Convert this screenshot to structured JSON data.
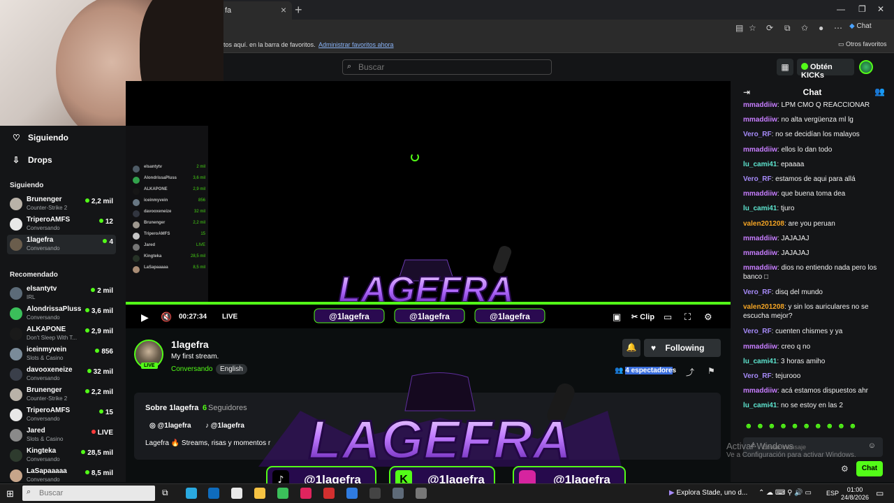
{
  "browser": {
    "tab_title": "fa",
    "favbar_text": "tos aquí. en la barra de favoritos.",
    "favbar_link": "Administrar favoritos ahora",
    "other_favs": "Otros favoritos",
    "copilot_label": "Chat"
  },
  "header": {
    "search_placeholder": "Buscar",
    "kicks_label": "Obtén KICKs"
  },
  "sidebar": {
    "nav": [
      {
        "label": "Siguiendo",
        "icon": "heart-icon"
      },
      {
        "label": "Drops",
        "icon": "drops-icon"
      }
    ],
    "following_title": "Siguiendo",
    "following": [
      {
        "name": "Brunenger",
        "category": "Counter-Strike 2",
        "viewers": "2,2 mil",
        "color": "#b9b2a8"
      },
      {
        "name": "TriperoAMFS",
        "category": "Conversando",
        "viewers": "12",
        "color": "#e8e8e8"
      },
      {
        "name": "1lagefra",
        "category": "Conversando",
        "viewers": "4",
        "color": "#6a5d4c"
      }
    ],
    "recommended_title": "Recomendado",
    "recommended": [
      {
        "name": "elsantytv",
        "category": "IRL",
        "viewers": "2 mil",
        "color": "#5c6b78"
      },
      {
        "name": "AlondrissaPluss",
        "category": "Conversando",
        "viewers": "3,6 mil",
        "color": "#3bbf5a"
      },
      {
        "name": "ALKAPONE",
        "category": "Don't Sleep With T...",
        "viewers": "2,9 mil",
        "color": "#1a1a1a"
      },
      {
        "name": "iceinmyvein",
        "category": "Slots & Casino",
        "viewers": "856",
        "color": "#7a8b99"
      },
      {
        "name": "davooxeneize",
        "category": "Conversando",
        "viewers": "32 mil",
        "color": "#3a3f4a"
      },
      {
        "name": "Brunenger",
        "category": "Counter-Strike 2",
        "viewers": "2,2 mil",
        "color": "#b9b2a8"
      },
      {
        "name": "TriperoAMFS",
        "category": "Conversando",
        "viewers": "15",
        "color": "#e8e8e8"
      },
      {
        "name": "Jared",
        "category": "Slots & Casino",
        "viewers": "LIVE",
        "color": "#8a8a8a"
      },
      {
        "name": "Kingteka",
        "category": "Conversando",
        "viewers": "28,5 mil",
        "color": "#2e3b2e"
      },
      {
        "name": "LaSapaaaaa",
        "category": "Conversando",
        "viewers": "8,5 mil",
        "color": "#c7a58a"
      }
    ]
  },
  "player": {
    "time": "00:27:34",
    "live": "LIVE",
    "clip": "Clip",
    "banner_text": "LAGEFRA",
    "banner_handle": "@1lagefra"
  },
  "channel": {
    "name": "1lagefra",
    "live_badge": "LIVE",
    "title": "My first stream.",
    "category": "Conversando",
    "language": "English",
    "follow_label": "Following",
    "viewers_highlight": "4 espectadore",
    "viewers_tail": "s"
  },
  "about": {
    "title": "Sobre 1lagefra",
    "followers_count": "6",
    "followers_label": "Seguidores",
    "instagram": "@1lagefra",
    "tiktok": "@1lagefra",
    "description": "Lagefra 🔥 Streams, risas y momentos r"
  },
  "chat": {
    "title": "Chat",
    "messages": [
      {
        "user": "mmaddiiw",
        "text": "LPM CMO Q REACCIONAR",
        "color": "#c77dff"
      },
      {
        "user": "mmaddiiw",
        "text": "no alta vergüenza ml lg",
        "color": "#c77dff"
      },
      {
        "user": "Vero_RF",
        "text": "no se decidían los malayos",
        "color": "#a78bfa"
      },
      {
        "user": "mmaddiiw",
        "text": "ellos lo dan todo",
        "color": "#c77dff"
      },
      {
        "user": "lu_cami41",
        "text": "epaaaa",
        "color": "#5ee6d0"
      },
      {
        "user": "Vero_RF",
        "text": "estamos de aqui para allá",
        "color": "#a78bfa"
      },
      {
        "user": "mmaddiiw",
        "text": "que buena toma dea",
        "color": "#c77dff"
      },
      {
        "user": "lu_cami41",
        "text": "tjuro",
        "color": "#5ee6d0"
      },
      {
        "user": "valen201208",
        "text": "are you peruan",
        "color": "#f5a524"
      },
      {
        "user": "mmaddiiw",
        "text": "JAJAJAJ",
        "color": "#c77dff"
      },
      {
        "user": "mmaddiiw",
        "text": "JAJAJAJ",
        "color": "#c77dff"
      },
      {
        "user": "mmaddiiw",
        "text": "dios no entiendo nada pero los banco □",
        "color": "#c77dff"
      },
      {
        "user": "Vero_RF",
        "text": "disq del mundo",
        "color": "#a78bfa"
      },
      {
        "user": "valen201208",
        "text": "y sin los auriculares no se escucha mejor?",
        "color": "#f5a524"
      },
      {
        "user": "Vero_RF",
        "text": "cuenten chismes y ya",
        "color": "#a78bfa"
      },
      {
        "user": "mmaddiiw",
        "text": "creo q no",
        "color": "#c77dff"
      },
      {
        "user": "lu_cami41",
        "text": "3 horas amiho",
        "color": "#5ee6d0"
      },
      {
        "user": "Vero_RF",
        "text": "tejurooo",
        "color": "#a78bfa"
      },
      {
        "user": "mmaddiiw",
        "text": "acá estamos dispuestos ahr",
        "color": "#c77dff"
      },
      {
        "user": "lu_cami41",
        "text": "no se estoy en las 2",
        "color": "#5ee6d0"
      }
    ],
    "input_placeholder": "Enviar mensaje",
    "send_label": "Chat"
  },
  "watermark": {
    "line1": "Activar Windows",
    "line2": "Ve a Configuración para activar Windows."
  },
  "taskbar": {
    "search_placeholder": "Buscar",
    "explora": "Explora Stade, uno d...",
    "lang": "ESP",
    "time": "01:00",
    "date": "24/8/2026"
  }
}
